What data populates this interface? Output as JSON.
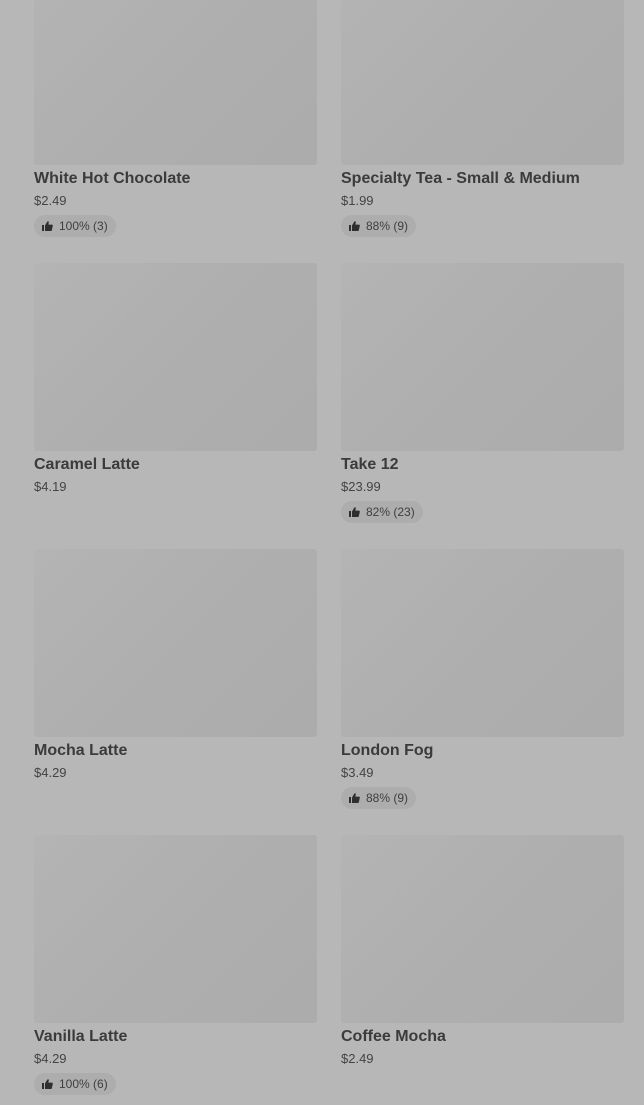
{
  "items": [
    {
      "name": "White Hot Chocolate",
      "price": "$2.49",
      "rating": "100% (3)"
    },
    {
      "name": "Specialty Tea - Small & Medium",
      "price": "$1.99",
      "rating": "88% (9)"
    },
    {
      "name": "Caramel Latte",
      "price": "$4.19",
      "rating": ""
    },
    {
      "name": "Take 12",
      "price": "$23.99",
      "rating": "82% (23)"
    },
    {
      "name": "Mocha Latte",
      "price": "$4.29",
      "rating": ""
    },
    {
      "name": "London Fog",
      "price": "$3.49",
      "rating": "88% (9)"
    },
    {
      "name": "Vanilla Latte",
      "price": "$4.29",
      "rating": "100% (6)"
    },
    {
      "name": "Coffee Mocha",
      "price": "$2.49",
      "rating": ""
    }
  ],
  "icons": {
    "rating": "thumbs-up-icon"
  },
  "colors": {
    "background": "#b7b7b7",
    "image_placeholder": "#afafaf",
    "rating_pill": "#adadad",
    "text": "#3b3b3b"
  }
}
